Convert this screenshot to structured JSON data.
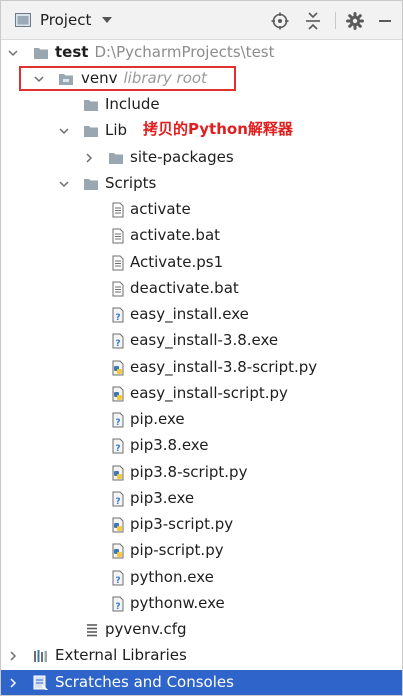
{
  "header": {
    "title": "Project"
  },
  "tree": {
    "root": {
      "name": "test",
      "path": "D:\\PycharmProjects\\test"
    },
    "venv": {
      "name": "venv",
      "tag": "library root"
    },
    "include": "Include",
    "lib": "Lib",
    "site_packages": "site-packages",
    "scripts": "Scripts",
    "files": [
      "activate",
      "activate.bat",
      "Activate.ps1",
      "deactivate.bat",
      "easy_install.exe",
      "easy_install-3.8.exe",
      "easy_install-3.8-script.py",
      "easy_install-script.py",
      "pip.exe",
      "pip3.8.exe",
      "pip3.8-script.py",
      "pip3.exe",
      "pip3-script.py",
      "pip-script.py",
      "python.exe",
      "pythonw.exe"
    ],
    "pyvenv": "pyvenv.cfg",
    "external_libraries": "External Libraries",
    "scratches": "Scratches and Consoles"
  },
  "annotation": "拷贝的Python解释器",
  "colors": {
    "selected": "#2f65ca",
    "annotation": "#e02020",
    "folder": "#9aa7b0"
  }
}
